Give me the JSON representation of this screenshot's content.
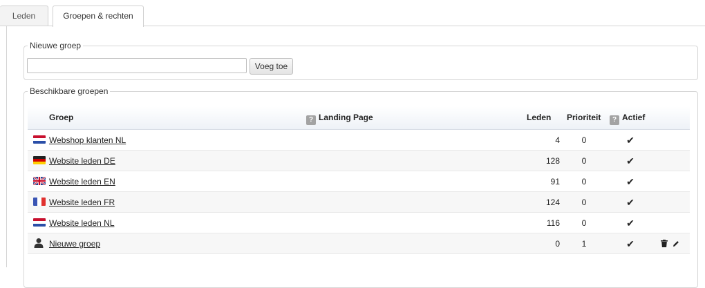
{
  "tabs": [
    {
      "label": "Leden"
    },
    {
      "label": "Groepen & rechten"
    }
  ],
  "new_group": {
    "legend": "Nieuwe groep",
    "input_value": "",
    "add_label": "Voeg toe"
  },
  "available": {
    "legend": "Beschikbare groepen",
    "columns": {
      "groep": "Groep",
      "landing": "Landing Page",
      "leden": "Leden",
      "prioriteit": "Prioriteit",
      "actief": "Actief",
      "help_glyph": "?"
    },
    "rows": [
      {
        "name": "Webshop klanten NL",
        "icon": "flag-nl-icon",
        "leden": "4",
        "prio": "0",
        "active": "✔"
      },
      {
        "name": "Website leden DE",
        "icon": "flag-de-icon",
        "leden": "128",
        "prio": "0",
        "active": "✔"
      },
      {
        "name": "Website leden EN",
        "icon": "flag-gb-icon",
        "leden": "91",
        "prio": "0",
        "active": "✔"
      },
      {
        "name": "Website leden FR",
        "icon": "flag-fr-icon",
        "leden": "124",
        "prio": "0",
        "active": "✔"
      },
      {
        "name": "Website leden NL",
        "icon": "flag-nl-icon",
        "leden": "116",
        "prio": "0",
        "active": "✔"
      },
      {
        "name": "Nieuwe groep",
        "icon": "user-icon",
        "leden": "0",
        "prio": "1",
        "active": "✔",
        "deletable": true
      }
    ]
  },
  "colors": {
    "header_gradient_end": "#eef2f7",
    "row_alt": "#f7f7f7"
  }
}
